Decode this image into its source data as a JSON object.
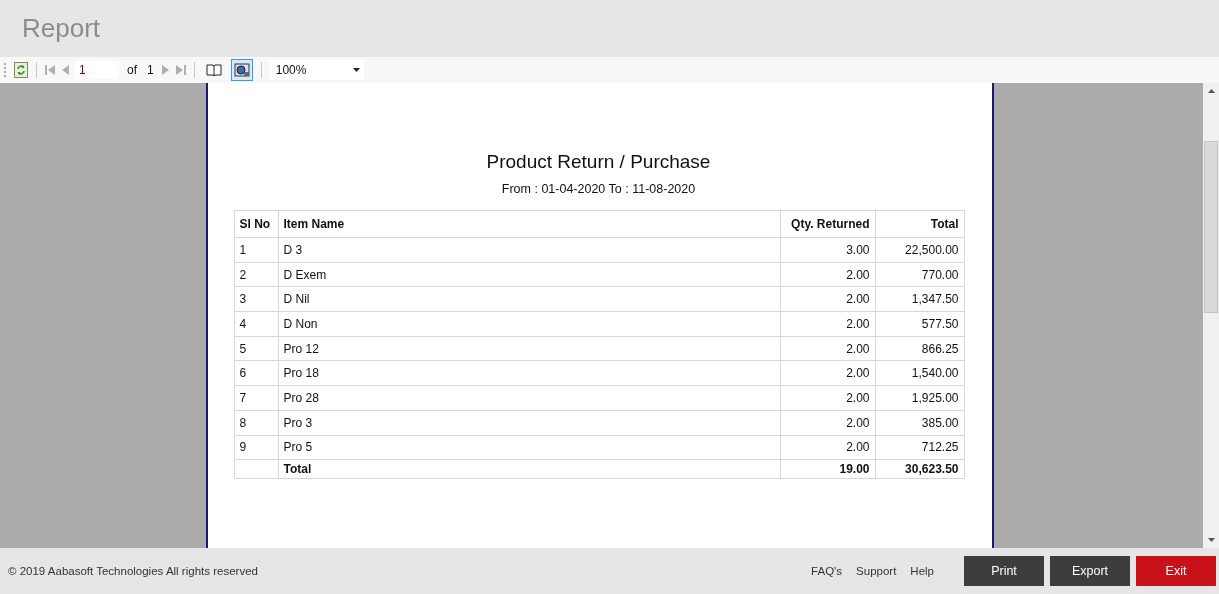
{
  "window": {
    "title": "Report"
  },
  "toolbar": {
    "page_input": "1",
    "of_label": "of",
    "page_count": "1",
    "zoom": "100%",
    "layout_selected": false,
    "page_setup_selected": true
  },
  "report": {
    "title": "Product Return / Purchase",
    "subtitle": "From : 01-04-2020 To : 11-08-2020",
    "columns": [
      {
        "label": "Sl No",
        "kind": "text"
      },
      {
        "label": "Item Name",
        "kind": "text"
      },
      {
        "label": "Qty. Returned",
        "kind": "number"
      },
      {
        "label": "Total",
        "kind": "number"
      }
    ],
    "rows": [
      [
        "1",
        "D 3",
        "3.00",
        "22,500.00"
      ],
      [
        "2",
        "D Exem",
        "2.00",
        "770.00"
      ],
      [
        "3",
        "D Nil",
        "2.00",
        "1,347.50"
      ],
      [
        "4",
        "D Non",
        "2.00",
        "577.50"
      ],
      [
        "5",
        "Pro 12",
        "2.00",
        "866.25"
      ],
      [
        "6",
        "Pro 18",
        "2.00",
        "1,540.00"
      ],
      [
        "7",
        "Pro 28",
        "2.00",
        "1,925.00"
      ],
      [
        "8",
        "Pro 3",
        "2.00",
        "385.00"
      ],
      [
        "9",
        "Pro 5",
        "2.00",
        "712.25"
      ]
    ],
    "total_row": {
      "label": "Total",
      "qty": "19.00",
      "total": "30,623.50"
    }
  },
  "footer": {
    "copyright": "© 2019 Aabasoft Technologies All rights reserved",
    "links": [
      "FAQ's",
      "Support",
      "Help"
    ],
    "buttons": [
      {
        "label": "Print",
        "kind": "dark"
      },
      {
        "label": "Export",
        "kind": "dark"
      },
      {
        "label": "Exit",
        "kind": "danger"
      }
    ]
  }
}
